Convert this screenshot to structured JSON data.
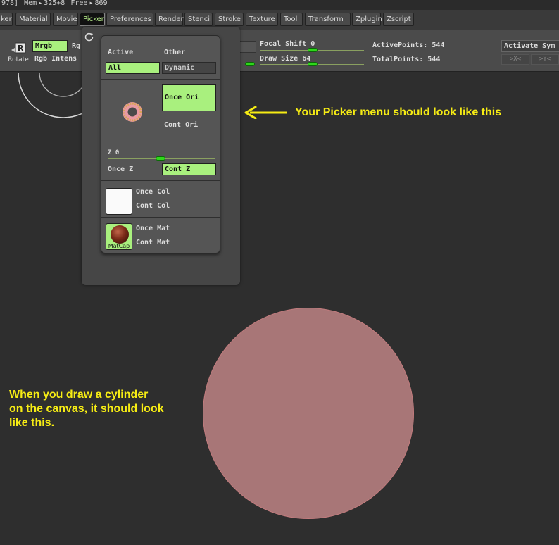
{
  "statusbar": {
    "left_value": "978]",
    "mem_label": "Mem",
    "mem_value": "325+8",
    "free_label": "Free",
    "free_value": "869"
  },
  "menubar": {
    "items": [
      "ker",
      "Material",
      "Movie",
      "Picker",
      "Preferences",
      "Render",
      "Stencil",
      "Stroke",
      "Texture",
      "Tool",
      "Transform",
      "Zplugin",
      "Zscript"
    ],
    "active": "Picker"
  },
  "shelf": {
    "rotate_label": "Rotate",
    "mrgb_label": "Mrgb",
    "rg_cut": "Rg",
    "rgb_intensity_label": "Rgb Intens",
    "focal_shift_label": "Focal Shift",
    "focal_shift_value": "0",
    "draw_size_label": "Draw Size",
    "draw_size_value": "64",
    "active_points_label": "ActivePoints:",
    "active_points_value": "544",
    "total_points_label": "TotalPoints:",
    "total_points_value": "544",
    "activate_symmetry_label": "Activate Sym",
    "x_axis_label": ">X<",
    "y_axis_label": ">Y<"
  },
  "picker_menu": {
    "active_header": "Active",
    "other_header": "Other",
    "active_value": "All",
    "other_value": "Dynamic",
    "once_ori": "Once Ori",
    "cont_ori": "Cont Ori",
    "z_label": "Z",
    "z_value": "0",
    "once_z": "Once Z",
    "cont_z": "Cont Z",
    "once_col": "Once Col",
    "cont_col": "Cont Col",
    "once_mat": "Once Mat",
    "cont_mat": "Cont Mat",
    "matcap_label": "MatCap"
  },
  "annotations": {
    "picker_note": "Your Picker menu should look like this",
    "canvas_note_line1": "When you draw a cylinder",
    "canvas_note_line2": "on the canvas, it should look",
    "canvas_note_line3": "like this."
  },
  "colors": {
    "accent_green": "#a9f07e",
    "slider_green": "#2fd61b",
    "annotation_yellow": "#f6ec14",
    "disc_fill": "#a87677"
  }
}
